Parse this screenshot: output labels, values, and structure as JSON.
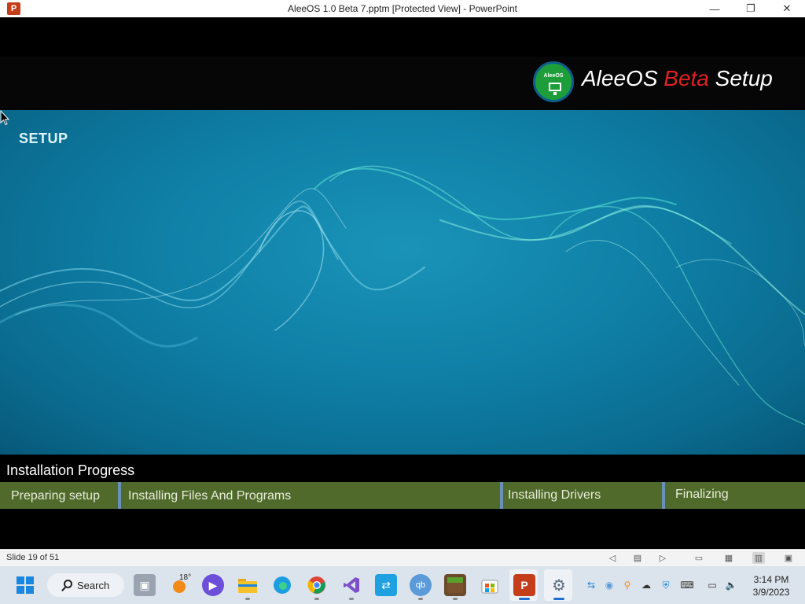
{
  "window": {
    "app_icon": "P",
    "title": "AleeOS 1.0 Beta 7.pptm [Protected View] - PowerPoint",
    "controls": {
      "minimize": "—",
      "maximize": "❐",
      "close": "✕"
    }
  },
  "slide": {
    "logo_text": "AleeOS",
    "brand_part1": "AleeOS ",
    "brand_accent": "Beta",
    "brand_part2": " Setup",
    "section_label": "SETUP",
    "progress_title": "Installation Progress",
    "stages": [
      "Preparing setup",
      "Installing Files And Programs",
      "Installing Drivers",
      "Finalizing"
    ],
    "colors": {
      "stage_bar": "#4f6a2b",
      "accent": "#e02020",
      "hero": "#0f7fa6",
      "logo": "#1d9e3a"
    }
  },
  "statusbar": {
    "slide_count": "Slide 19 of 51",
    "view_buttons": [
      "prev-icon",
      "notes-icon",
      "next-icon",
      "normal-view-icon",
      "slide-sorter-icon",
      "reading-view-icon",
      "slideshow-icon"
    ]
  },
  "taskbar": {
    "search_label": "Search",
    "weather_temp": "18°",
    "apps": [
      "start",
      "task-view",
      "weather",
      "meet",
      "file-explorer",
      "edge",
      "chrome",
      "visual-studio",
      "remote-desktop",
      "qbittorrent",
      "minecraft",
      "store",
      "powerpoint",
      "settings"
    ],
    "clock_time": "3:14 PM",
    "clock_date": "3/9/2023"
  }
}
